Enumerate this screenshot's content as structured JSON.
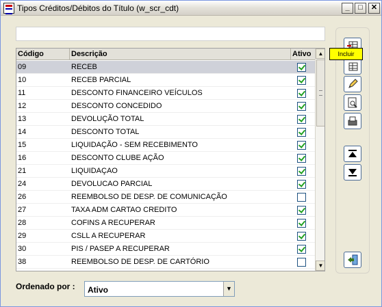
{
  "window": {
    "title": "Tipos Créditos/Débitos do Título (w_scr_cdt)",
    "min_glyph": "_",
    "max_glyph": "□",
    "close_glyph": "✕"
  },
  "filter": {
    "value": ""
  },
  "grid": {
    "columns": [
      "Código",
      "Descrição",
      "Ativo"
    ],
    "rows": [
      {
        "codigo": "09",
        "descricao": "RECEB",
        "ativo": true
      },
      {
        "codigo": "10",
        "descricao": "RECEB PARCIAL",
        "ativo": true
      },
      {
        "codigo": "11",
        "descricao": "DESCONTO FINANCEIRO VEÍCULOS",
        "ativo": true
      },
      {
        "codigo": "12",
        "descricao": "DESCONTO CONCEDIDO",
        "ativo": true
      },
      {
        "codigo": "13",
        "descricao": "DEVOLUÇÃO TOTAL",
        "ativo": true
      },
      {
        "codigo": "14",
        "descricao": "DESCONTO TOTAL",
        "ativo": true
      },
      {
        "codigo": "15",
        "descricao": "LIQUIDAÇÃO - SEM RECEBIMENTO",
        "ativo": true
      },
      {
        "codigo": "16",
        "descricao": "DESCONTO CLUBE AÇÃO",
        "ativo": true
      },
      {
        "codigo": "21",
        "descricao": "LIQUIDAÇAO",
        "ativo": true
      },
      {
        "codigo": "24",
        "descricao": "DEVOLUCAO PARCIAL",
        "ativo": true
      },
      {
        "codigo": "26",
        "descricao": "REEMBOLSO DE DESP. DE COMUNICAÇÃO",
        "ativo": false
      },
      {
        "codigo": "27",
        "descricao": "TAXA ADM CARTAO CREDITO",
        "ativo": true
      },
      {
        "codigo": "28",
        "descricao": "COFINS A RECUPERAR",
        "ativo": true
      },
      {
        "codigo": "29",
        "descricao": "CSLL A RECUPERAR",
        "ativo": true
      },
      {
        "codigo": "30",
        "descricao": "PIS / PASEP A RECUPERAR",
        "ativo": true
      },
      {
        "codigo": "38",
        "descricao": "REEMBOLSO DE DESP. DE CARTÓRIO",
        "ativo": false
      }
    ],
    "selected_row": 0
  },
  "toolbar": {
    "tooltip": "Incluir",
    "icons": [
      "insert-row-icon",
      "edit-grid-icon",
      "pencil-icon",
      "print-preview-icon",
      "print-icon",
      "move-up-icon",
      "move-down-icon",
      "exit-door-icon"
    ]
  },
  "ordering": {
    "label": "Ordenado por :",
    "selected": "Ativo"
  },
  "colors": {
    "check": "#21a121",
    "selected_row": "#cfd1d9",
    "tooltip_bg": "#ffff00"
  }
}
